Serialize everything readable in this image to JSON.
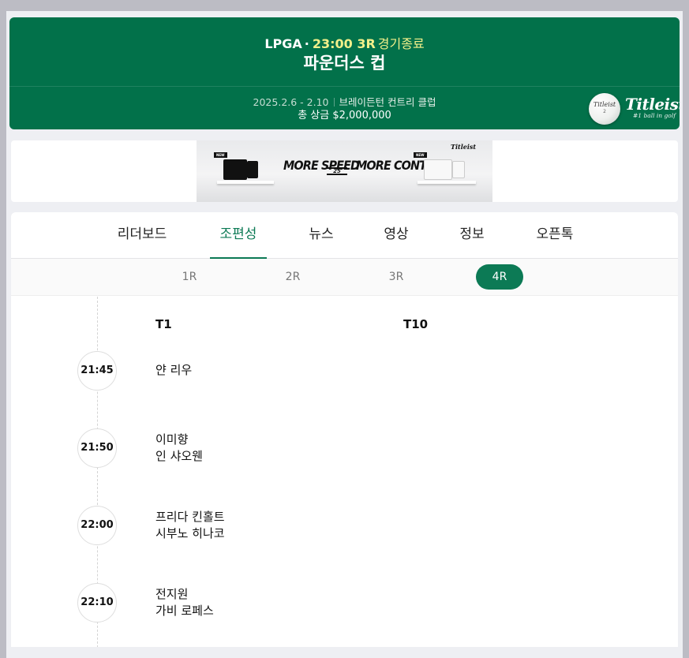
{
  "header": {
    "tour": "LPGA",
    "dot": "·",
    "time": "23:00 3R",
    "state": "경기종료",
    "title": "파운더스 컵",
    "dates": "2025.2.6 - 2.10",
    "venue": "브레이든턴 컨트리 클럽",
    "prize": "총 상금 $2,000,000",
    "sponsor": {
      "logo": "Titleist",
      "tagline": "#1 ball in golf",
      "ball_text": "Titleist",
      "ball_number": "2"
    }
  },
  "ad": {
    "left_text": "MORE SPEED",
    "right_text": "MORE CONTROL",
    "center_mark": "25",
    "brand": "Titleist",
    "new_tag": "NEW"
  },
  "tabs": [
    {
      "label": "리더보드",
      "active": false
    },
    {
      "label": "조편성",
      "active": true
    },
    {
      "label": "뉴스",
      "active": false
    },
    {
      "label": "영상",
      "active": false
    },
    {
      "label": "정보",
      "active": false
    },
    {
      "label": "오픈톡",
      "active": false
    }
  ],
  "rounds": [
    {
      "label": "1R",
      "active": false
    },
    {
      "label": "2R",
      "active": false
    },
    {
      "label": "3R",
      "active": false
    },
    {
      "label": "4R",
      "active": true
    }
  ],
  "tees": {
    "left": "T1",
    "right": "T10"
  },
  "slots": [
    {
      "time": "21:45",
      "players": [
        "얀 리우"
      ]
    },
    {
      "time": "21:50",
      "players": [
        "이미향",
        "인 샤오웬"
      ]
    },
    {
      "time": "22:00",
      "players": [
        "프리다 킨홀트",
        "시부노 히나코"
      ]
    },
    {
      "time": "22:10",
      "players": [
        "전지원",
        "가비 로페스"
      ]
    }
  ],
  "colors": {
    "brand_green": "#02714a",
    "accent_green": "#0c7a55",
    "highlight_yellow": "#f2f08a"
  }
}
